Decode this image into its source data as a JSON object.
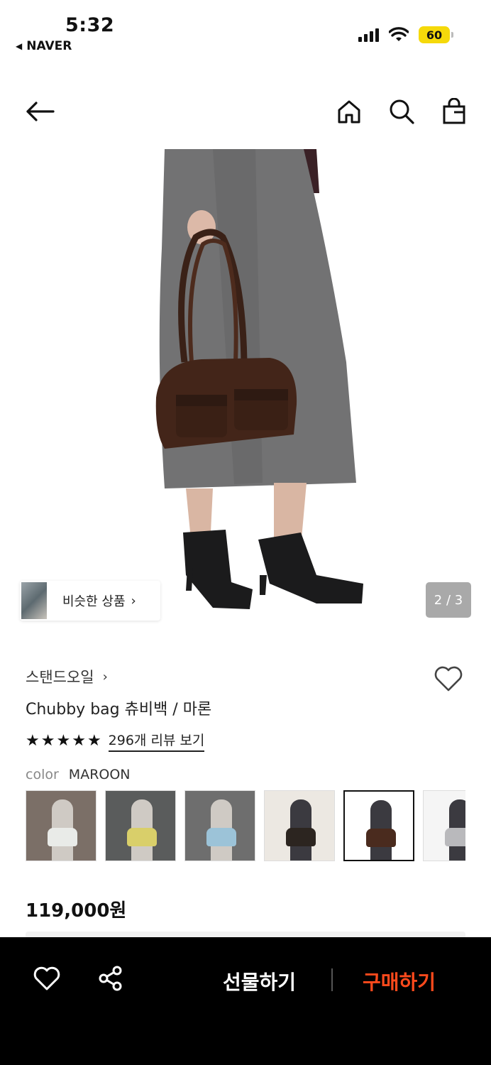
{
  "status_bar": {
    "time": "5:32",
    "back_app": "NAVER",
    "battery": "60"
  },
  "hero": {
    "similar_label": "비슷한 상품",
    "pager": "2 / 3"
  },
  "product": {
    "brand": "스탠드오일",
    "title": "Chubby bag 츄비백 / 마론",
    "rating_stars": 5,
    "review_link": "296개 리뷰 보기",
    "color_key": "color",
    "color_value": "MAROON",
    "price": "119,000원"
  },
  "swatches": [
    {
      "name": "swatch-1",
      "bag_color": "#e9ebe8",
      "bg": "#7b6f67",
      "active": false
    },
    {
      "name": "swatch-2",
      "bag_color": "#d9cf6a",
      "bg": "#5a5c5c",
      "active": false
    },
    {
      "name": "swatch-3",
      "bag_color": "#9cc3d8",
      "bg": "#6e6e6e",
      "active": false
    },
    {
      "name": "swatch-4",
      "bag_color": "#2c2520",
      "bg": "#ece8e2",
      "active": false
    },
    {
      "name": "swatch-5",
      "bag_color": "#4a2b1e",
      "bg": "#ffffff",
      "active": true
    },
    {
      "name": "swatch-6",
      "bag_color": "#b9b9bc",
      "bg": "#f5f5f5",
      "active": false
    }
  ],
  "bottom_bar": {
    "gift_label": "선물하기",
    "buy_label": "구매하기",
    "buy_color": "#ff4a1c"
  }
}
